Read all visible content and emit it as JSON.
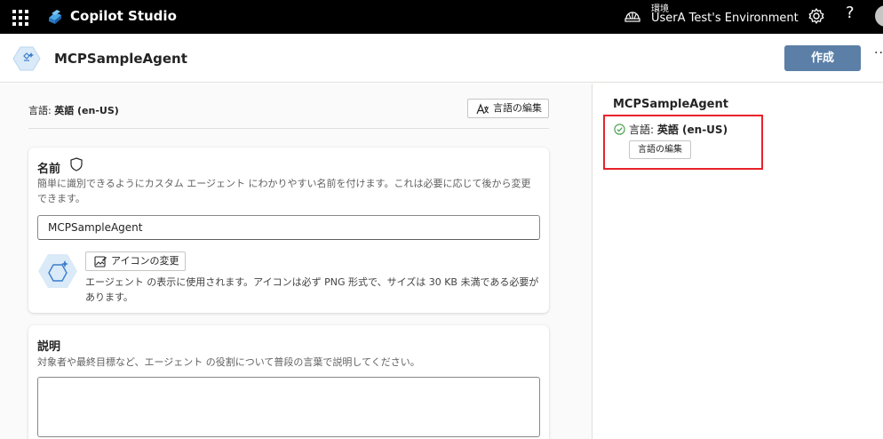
{
  "topbar": {
    "app_title": "Copilot Studio",
    "env_label": "環境",
    "env_name": "UserA Test's Environment",
    "help_glyph": "?"
  },
  "header": {
    "agent_name": "MCPSampleAgent",
    "create_label": "作成",
    "more_glyph": "···"
  },
  "left": {
    "language_prefix": "言語: ",
    "language_value": "英語 (en-US)",
    "edit_language_label": "言語の編集",
    "name_card": {
      "title": "名前",
      "help": "簡単に識別できるようにカスタム エージェント にわかりやすい名前を付けます。これは必要に応じて後から変更できます。",
      "value": "MCPSampleAgent",
      "change_icon_label": "アイコンの変更",
      "icon_help": "エージェント の表示に使用されます。アイコンは必ず PNG 形式で、サイズは 30 KB 未満である必要があります。"
    },
    "description_card": {
      "title": "説明",
      "help": "対象者や最終目標など、エージェント の役割について普段の言葉で説明してください。",
      "value": ""
    }
  },
  "right": {
    "agent_name": "MCPSampleAgent",
    "language_prefix": "言語: ",
    "language_value": "英語 (en-US)",
    "edit_language_label": "言語の編集"
  },
  "colors": {
    "topbar_bg": "#000000",
    "primary_button": "#5b7fa6",
    "highlight": "#e8232a",
    "success": "#3f9b45"
  }
}
